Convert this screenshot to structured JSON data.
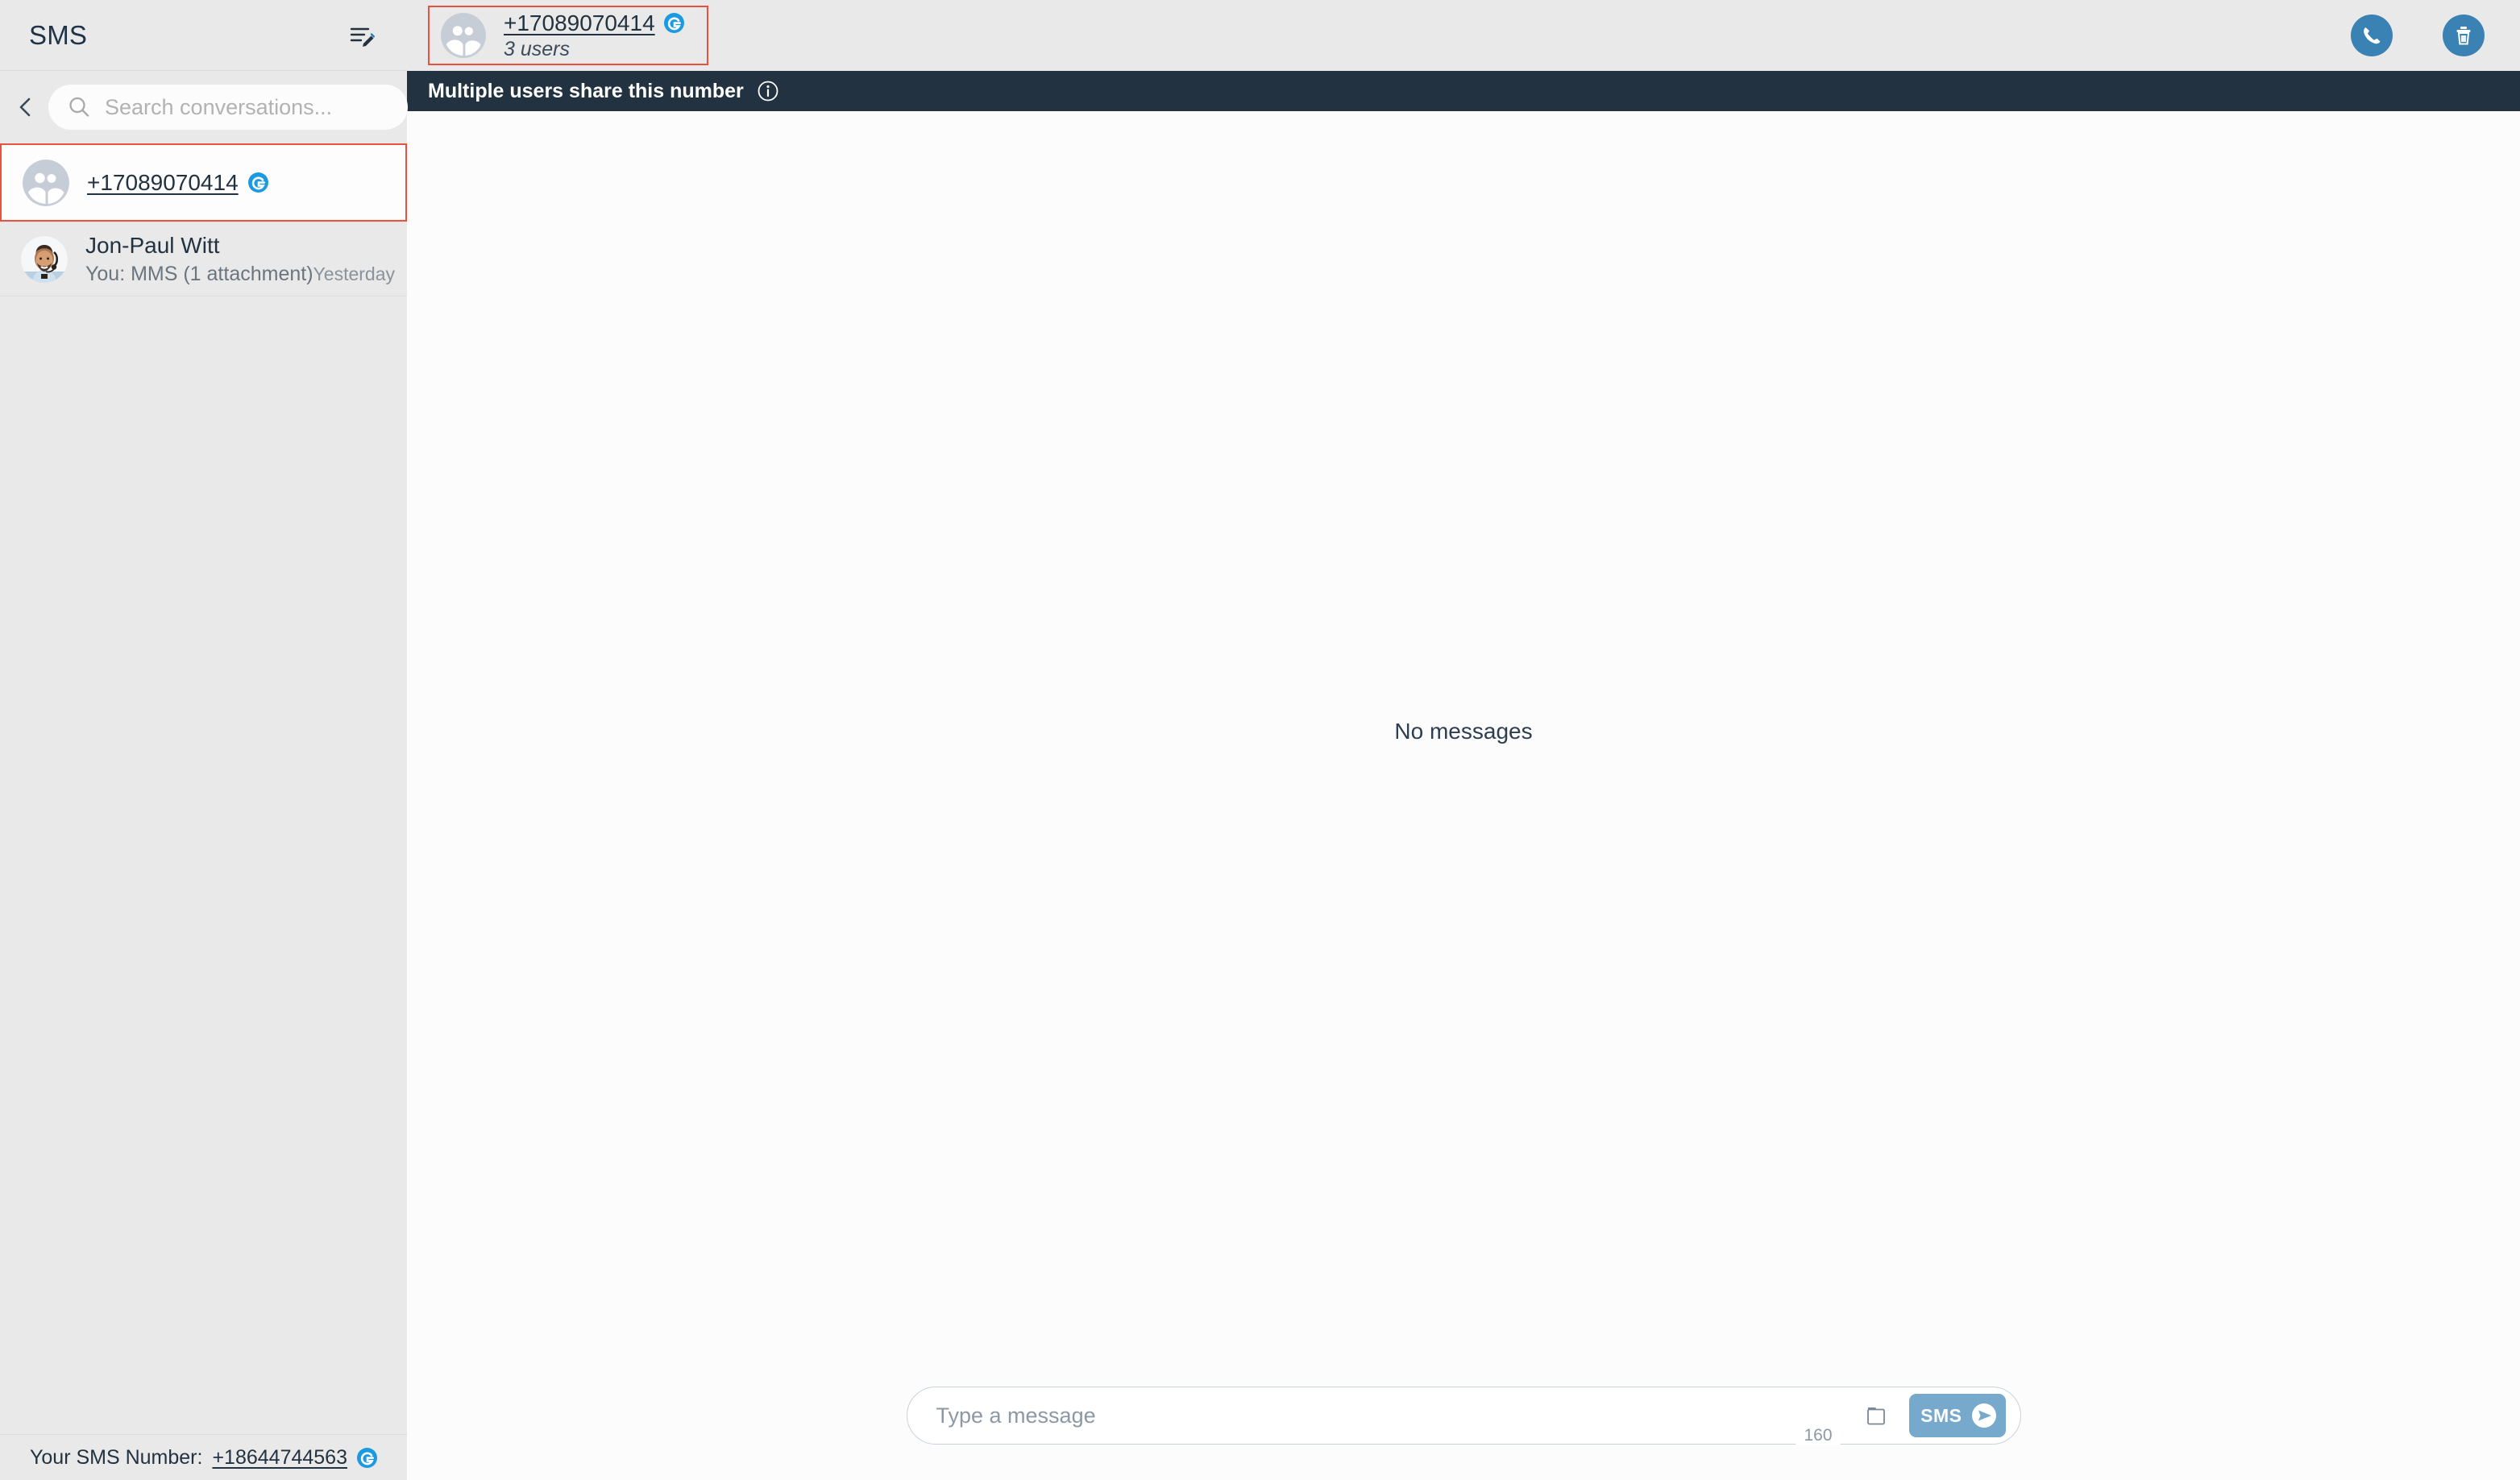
{
  "colors": {
    "sidebar_bg": "#e9e9e9",
    "main_bg": "#fcfcfc",
    "notice_bg": "#233240",
    "accent_blue": "#3b82b4",
    "send_blue": "#76a9cc",
    "selection_red": "#e8533f",
    "badge_blue": "#1a9ae0",
    "text_dark": "#233240"
  },
  "sidebar": {
    "title": "SMS",
    "compose_icon": "compose-message-icon",
    "back_icon": "chevron-left-icon",
    "search": {
      "icon": "search-icon",
      "placeholder": "Search conversations...",
      "value": ""
    },
    "conversations": [
      {
        "name": "+17089070414",
        "avatar_icon": "group-avatar-icon",
        "badge_icon": "crm-badge-icon",
        "selected": true,
        "preview": "",
        "time": ""
      },
      {
        "name": "Jon-Paul Witt",
        "avatar_icon": "user-photo-avatar",
        "selected": false,
        "preview": "You: MMS (1 attachment)",
        "time": "Yesterday"
      }
    ],
    "footer": {
      "label": "Your SMS Number:",
      "number": "+18644744563",
      "badge_icon": "crm-badge-icon"
    }
  },
  "main": {
    "thread": {
      "number": "+17089070414",
      "subtitle": "3 users",
      "avatar_icon": "group-avatar-icon",
      "badge_icon": "crm-badge-icon"
    },
    "actions": [
      {
        "name": "call-button",
        "icon": "phone-icon"
      },
      {
        "name": "delete-button",
        "icon": "trash-icon"
      }
    ],
    "notice": {
      "text": "Multiple users share this number",
      "icon": "info-circle-icon"
    },
    "empty_state": "No messages",
    "composer": {
      "placeholder": "Type a message",
      "value": "",
      "attach_icon": "folder-attachment-icon",
      "send_label": "SMS",
      "send_icon": "send-arrow-icon",
      "char_counter": "160"
    }
  }
}
